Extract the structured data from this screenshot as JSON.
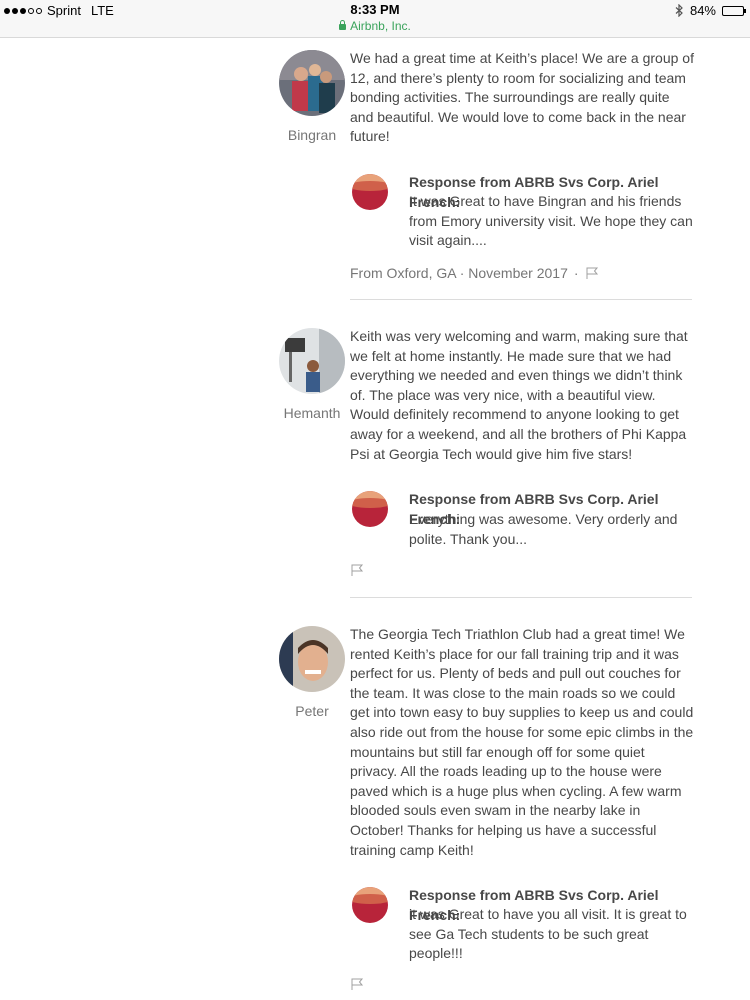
{
  "status_bar": {
    "carrier": "Sprint",
    "network": "LTE",
    "time": "8:33 PM",
    "site": "Airbnb, Inc.",
    "battery": "84%",
    "battery_level": 0.84
  },
  "reviews": [
    {
      "name": "Bingran",
      "text": "We had a great time at Keith’s place! We are a group of 12, and there’s plenty to room for socializing and team bonding activities. The surroundings are really quite and beautiful. We would love to come back in the near future!",
      "response_heading": "Response from ABRB Svs Corp. Ariel French:",
      "response_text": "It was Great to have Bingran and his friends from Emory university visit. We hope they can visit again....",
      "meta": "From Oxford, GA · November 2017",
      "meta_sep": "·"
    },
    {
      "name": "Hemanth",
      "text": "Keith was very welcoming and warm, making sure that we felt at home instantly. He made sure that we had everything we needed and even things we didn’t think of. The place was very nice, with a beautiful view. Would definitely recommend to anyone looking to get away for a weekend, and all the brothers of Phi Kappa Psi at Georgia Tech would give him five stars!",
      "response_heading": "Response from ABRB Svs Corp. Ariel French:",
      "response_text": "Everything was awesome. Very orderly and polite. Thank you..."
    },
    {
      "name": "Peter",
      "text": "The Georgia Tech Triathlon Club had a great time! We rented Keith’s place for our fall training trip and it was perfect for us. Plenty of beds and pull out couches for the team. It was close to the main roads so we could get into town easy to buy supplies to keep us and could also ride out from the house for some epic climbs in the mountains but still far enough off for some quiet privacy. All the roads leading up to the house were paved which is a huge plus when cycling. A few warm blooded souls even swam in the nearby lake in October! Thanks for helping us have a successful training camp Keith!",
      "response_heading": "Response from ABRB Svs Corp. Ariel French:",
      "response_text": "it was Great to have you all visit. It is great to see Ga Tech students to be such great people!!!"
    }
  ],
  "icons": {
    "flag": "flag-icon",
    "lock": "lock-icon",
    "bluetooth": "bluetooth-icon",
    "battery": "battery-icon"
  },
  "colors": {
    "secure_green": "#3aa35b",
    "text": "#484848",
    "muted": "#767676"
  }
}
